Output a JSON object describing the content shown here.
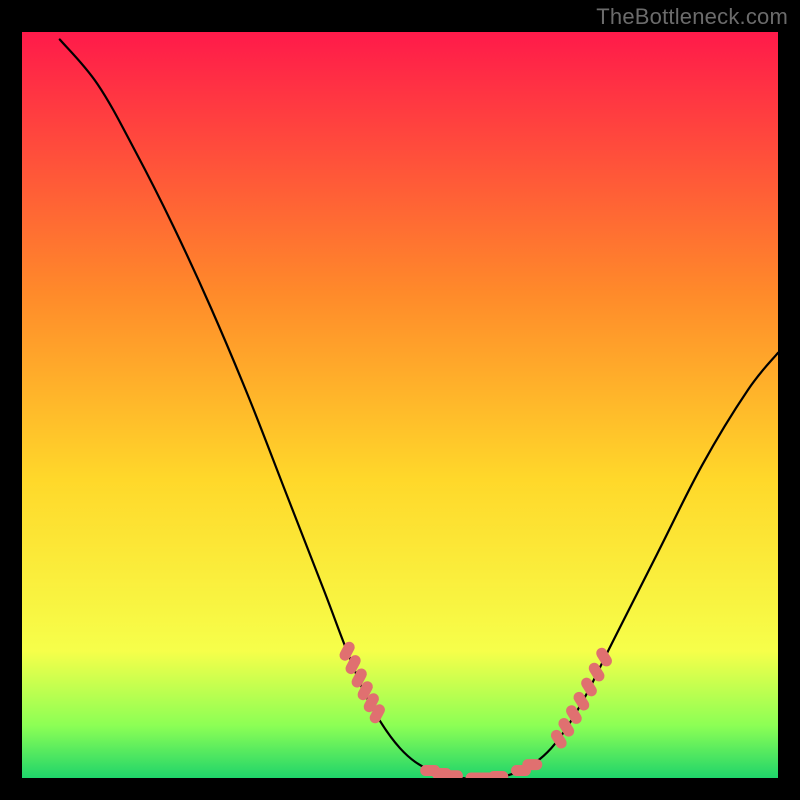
{
  "watermark": "TheBottleneck.com",
  "colors": {
    "background": "#000000",
    "gradient_top": "#ff1a4a",
    "gradient_mid_upper": "#ff8a2a",
    "gradient_mid": "#ffd82a",
    "gradient_lower": "#f6ff4a",
    "gradient_green_band": "#8cff55",
    "gradient_bottom": "#1fd46a",
    "curve": "#000000",
    "marker": "#e07070"
  },
  "chart_data": {
    "type": "line",
    "title": "",
    "xlabel": "",
    "ylabel": "",
    "x_range": [
      0,
      100
    ],
    "y_range": [
      0,
      100
    ],
    "curve": [
      {
        "x": 5,
        "y": 99
      },
      {
        "x": 10,
        "y": 93
      },
      {
        "x": 15,
        "y": 84
      },
      {
        "x": 20,
        "y": 74
      },
      {
        "x": 25,
        "y": 63
      },
      {
        "x": 30,
        "y": 51
      },
      {
        "x": 35,
        "y": 38
      },
      {
        "x": 40,
        "y": 25
      },
      {
        "x": 43,
        "y": 17
      },
      {
        "x": 46,
        "y": 10
      },
      {
        "x": 50,
        "y": 4
      },
      {
        "x": 54,
        "y": 1
      },
      {
        "x": 58,
        "y": 0
      },
      {
        "x": 62,
        "y": 0
      },
      {
        "x": 66,
        "y": 1
      },
      {
        "x": 70,
        "y": 4
      },
      {
        "x": 74,
        "y": 10
      },
      {
        "x": 78,
        "y": 18
      },
      {
        "x": 84,
        "y": 30
      },
      {
        "x": 90,
        "y": 42
      },
      {
        "x": 96,
        "y": 52
      },
      {
        "x": 100,
        "y": 57
      }
    ],
    "markers_left": [
      {
        "x": 43.0,
        "y": 17.0
      },
      {
        "x": 43.8,
        "y": 15.2
      },
      {
        "x": 44.6,
        "y": 13.4
      },
      {
        "x": 45.4,
        "y": 11.7
      },
      {
        "x": 46.2,
        "y": 10.1
      },
      {
        "x": 47.0,
        "y": 8.6
      }
    ],
    "markers_bottom": [
      {
        "x": 54.0,
        "y": 1.0
      },
      {
        "x": 55.5,
        "y": 0.6
      },
      {
        "x": 57.0,
        "y": 0.3
      },
      {
        "x": 60.0,
        "y": 0.0
      },
      {
        "x": 61.5,
        "y": 0.0
      },
      {
        "x": 63.0,
        "y": 0.2
      },
      {
        "x": 66.0,
        "y": 1.0
      },
      {
        "x": 67.5,
        "y": 1.8
      }
    ],
    "markers_right": [
      {
        "x": 71.0,
        "y": 5.2
      },
      {
        "x": 72.0,
        "y": 6.8
      },
      {
        "x": 73.0,
        "y": 8.5
      },
      {
        "x": 74.0,
        "y": 10.3
      },
      {
        "x": 75.0,
        "y": 12.2
      },
      {
        "x": 76.0,
        "y": 14.2
      },
      {
        "x": 77.0,
        "y": 16.2
      }
    ]
  }
}
